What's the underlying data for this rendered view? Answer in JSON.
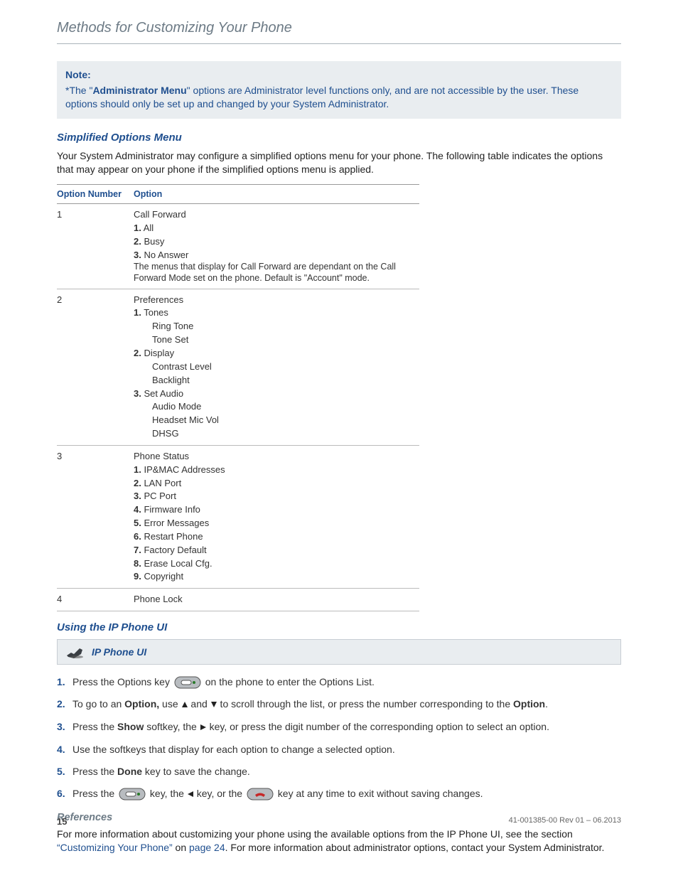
{
  "header": {
    "title": "Methods for Customizing Your Phone"
  },
  "note": {
    "title": "Note:",
    "prefix": "*The \"",
    "bold": "Administrator Menu",
    "rest": "\" options are Administrator level functions only, and are not accessible by the user. These options should only be set up and changed by your System Administrator."
  },
  "simplified": {
    "heading": "Simplified Options Menu",
    "intro": "Your System Administrator may configure a simplified options menu for your phone. The following table indicates the options that may appear on your phone if the simplified options menu is applied."
  },
  "table": {
    "col1": "Option Number",
    "col2": "Option",
    "rows": [
      {
        "num": "1",
        "title": "Call Forward",
        "items": [
          {
            "n": "1.",
            "t": "All"
          },
          {
            "n": "2.",
            "t": "Busy"
          },
          {
            "n": "3.",
            "t": "No Answer"
          }
        ],
        "note": "The menus that display for Call Forward are dependant on the Call Forward Mode set on the phone. Default is \"Account\" mode."
      },
      {
        "num": "2",
        "title": "Preferences",
        "groups": [
          {
            "n": "1.",
            "t": "Tones",
            "subs": [
              "Ring Tone",
              "Tone Set"
            ]
          },
          {
            "n": "2.",
            "t": "Display",
            "subs": [
              "Contrast Level",
              "Backlight"
            ]
          },
          {
            "n": "3.",
            "t": "Set Audio",
            "subs": [
              "Audio Mode",
              "Headset Mic Vol",
              "DHSG"
            ]
          }
        ]
      },
      {
        "num": "3",
        "title": "Phone Status",
        "items": [
          {
            "n": "1.",
            "t": "IP&MAC Addresses"
          },
          {
            "n": "2.",
            "t": "LAN Port"
          },
          {
            "n": "3.",
            "t": "PC Port"
          },
          {
            "n": "4.",
            "t": "Firmware Info"
          },
          {
            "n": "5.",
            "t": "Error Messages"
          },
          {
            "n": "6.",
            "t": "Restart Phone"
          },
          {
            "n": "7.",
            "t": "Factory Default"
          },
          {
            "n": "8.",
            "t": "Erase Local Cfg."
          },
          {
            "n": "9.",
            "t": "Copyright"
          }
        ]
      },
      {
        "num": "4",
        "title": "Phone Lock"
      }
    ]
  },
  "using": {
    "heading": "Using the IP Phone UI",
    "callout": "IP Phone UI"
  },
  "steps": {
    "s1a": "Press the Options key ",
    "s1b": " on the phone to enter the Options List.",
    "s2a": "To go to an ",
    "s2b": "Option,",
    "s2c": " use ",
    "s2d": " and ",
    "s2e": " to scroll through the list, or press the number corresponding to the ",
    "s2f": "Option",
    "s2g": ".",
    "s3a": "Press the ",
    "s3b": "Show",
    "s3c": " softkey, the ",
    "s3d": " key, or press the digit number of the corresponding option to select an option.",
    "s4": "Use the softkeys that display for each option to change a selected option.",
    "s5a": "Press the ",
    "s5b": "Done",
    "s5c": " key to save the change.",
    "s6a": "Press the ",
    "s6b": " key, the ",
    "s6c": " key, or the ",
    "s6d": " key at any time to exit without saving changes."
  },
  "refs": {
    "heading": "References",
    "p1a": "For more information about customizing your phone using the available options from the IP Phone UI, see the section ",
    "link1": "“Customizing Your Phone”",
    "p1b": " on ",
    "link2": "page 24",
    "p1c": ". For more information about administrator options, contact your System Administrator."
  },
  "footer": {
    "page": "15",
    "rev": "41-001385-00 Rev 01 – 06.2013"
  }
}
